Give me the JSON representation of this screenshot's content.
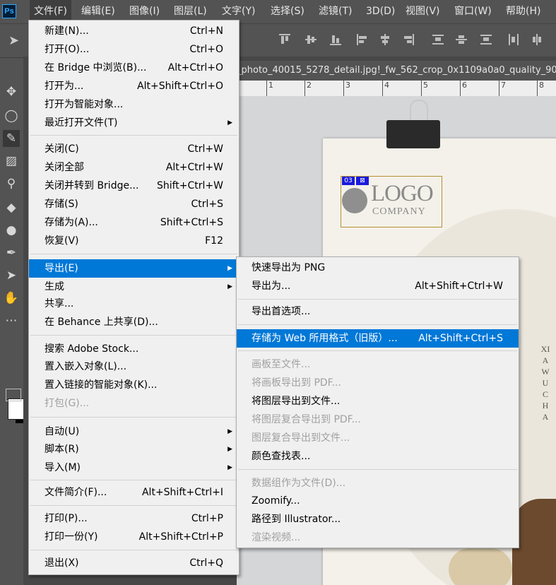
{
  "app": {
    "logo": "Ps"
  },
  "menubar": {
    "items": [
      "文件(F)",
      "编辑(E)",
      "图像(I)",
      "图层(L)",
      "文字(Y)",
      "选择(S)",
      "滤镜(T)",
      "3D(D)",
      "视图(V)",
      "窗口(W)",
      "帮助(H)"
    ]
  },
  "document": {
    "tab_title": "_photo_40015_5278_detail.jpg!_fw_562_crop_0x1109a0a0_quality_90",
    "ruler_ticks": [
      "1",
      "2",
      "3",
      "4",
      "5",
      "6",
      "7",
      "8"
    ]
  },
  "canvas": {
    "logo_text": "LOGO",
    "logo_company": "COMPANY",
    "logo_tag1": "03",
    "logo_tag2": "⊠",
    "vertical_text": "XIAWUCHA"
  },
  "file_menu": {
    "items": [
      {
        "label": "新建(N)...",
        "shortcut": "Ctrl+N"
      },
      {
        "label": "打开(O)...",
        "shortcut": "Ctrl+O"
      },
      {
        "label": "在 Bridge 中浏览(B)...",
        "shortcut": "Alt+Ctrl+O"
      },
      {
        "label": "打开为...",
        "shortcut": "Alt+Shift+Ctrl+O"
      },
      {
        "label": "打开为智能对象...",
        "shortcut": ""
      },
      {
        "label": "最近打开文件(T)",
        "shortcut": ""
      },
      {
        "label": "关闭(C)",
        "shortcut": "Ctrl+W"
      },
      {
        "label": "关闭全部",
        "shortcut": "Alt+Ctrl+W"
      },
      {
        "label": "关闭并转到 Bridge...",
        "shortcut": "Shift+Ctrl+W"
      },
      {
        "label": "存储(S)",
        "shortcut": "Ctrl+S"
      },
      {
        "label": "存储为(A)...",
        "shortcut": "Shift+Ctrl+S"
      },
      {
        "label": "恢复(V)",
        "shortcut": "F12"
      },
      {
        "label": "导出(E)",
        "shortcut": ""
      },
      {
        "label": "生成",
        "shortcut": ""
      },
      {
        "label": "共享...",
        "shortcut": ""
      },
      {
        "label": "在 Behance 上共享(D)...",
        "shortcut": ""
      },
      {
        "label": "搜索 Adobe Stock...",
        "shortcut": ""
      },
      {
        "label": "置入嵌入对象(L)...",
        "shortcut": ""
      },
      {
        "label": "置入链接的智能对象(K)...",
        "shortcut": ""
      },
      {
        "label": "打包(G)...",
        "shortcut": ""
      },
      {
        "label": "自动(U)",
        "shortcut": ""
      },
      {
        "label": "脚本(R)",
        "shortcut": ""
      },
      {
        "label": "导入(M)",
        "shortcut": ""
      },
      {
        "label": "文件简介(F)...",
        "shortcut": "Alt+Shift+Ctrl+I"
      },
      {
        "label": "打印(P)...",
        "shortcut": "Ctrl+P"
      },
      {
        "label": "打印一份(Y)",
        "shortcut": "Alt+Shift+Ctrl+P"
      },
      {
        "label": "退出(X)",
        "shortcut": "Ctrl+Q"
      }
    ]
  },
  "export_menu": {
    "items": [
      {
        "label": "快速导出为 PNG",
        "shortcut": ""
      },
      {
        "label": "导出为...",
        "shortcut": "Alt+Shift+Ctrl+W"
      },
      {
        "label": "导出首选项...",
        "shortcut": ""
      },
      {
        "label": "存储为 Web 所用格式（旧版）...",
        "shortcut": "Alt+Shift+Ctrl+S"
      },
      {
        "label": "画板至文件...",
        "shortcut": ""
      },
      {
        "label": "将画板导出到 PDF...",
        "shortcut": ""
      },
      {
        "label": "将图层导出到文件...",
        "shortcut": ""
      },
      {
        "label": "将图层复合导出到 PDF...",
        "shortcut": ""
      },
      {
        "label": "图层复合导出到文件...",
        "shortcut": ""
      },
      {
        "label": "颜色查找表...",
        "shortcut": ""
      },
      {
        "label": "数据组作为文件(D)...",
        "shortcut": ""
      },
      {
        "label": "Zoomify...",
        "shortcut": ""
      },
      {
        "label": "路径到 Illustrator...",
        "shortcut": ""
      },
      {
        "label": "渲染视频...",
        "shortcut": ""
      }
    ]
  },
  "colors": {
    "highlight": "#0078d7",
    "menu_bg": "#f0f0f0",
    "ui_bg": "#535353"
  }
}
